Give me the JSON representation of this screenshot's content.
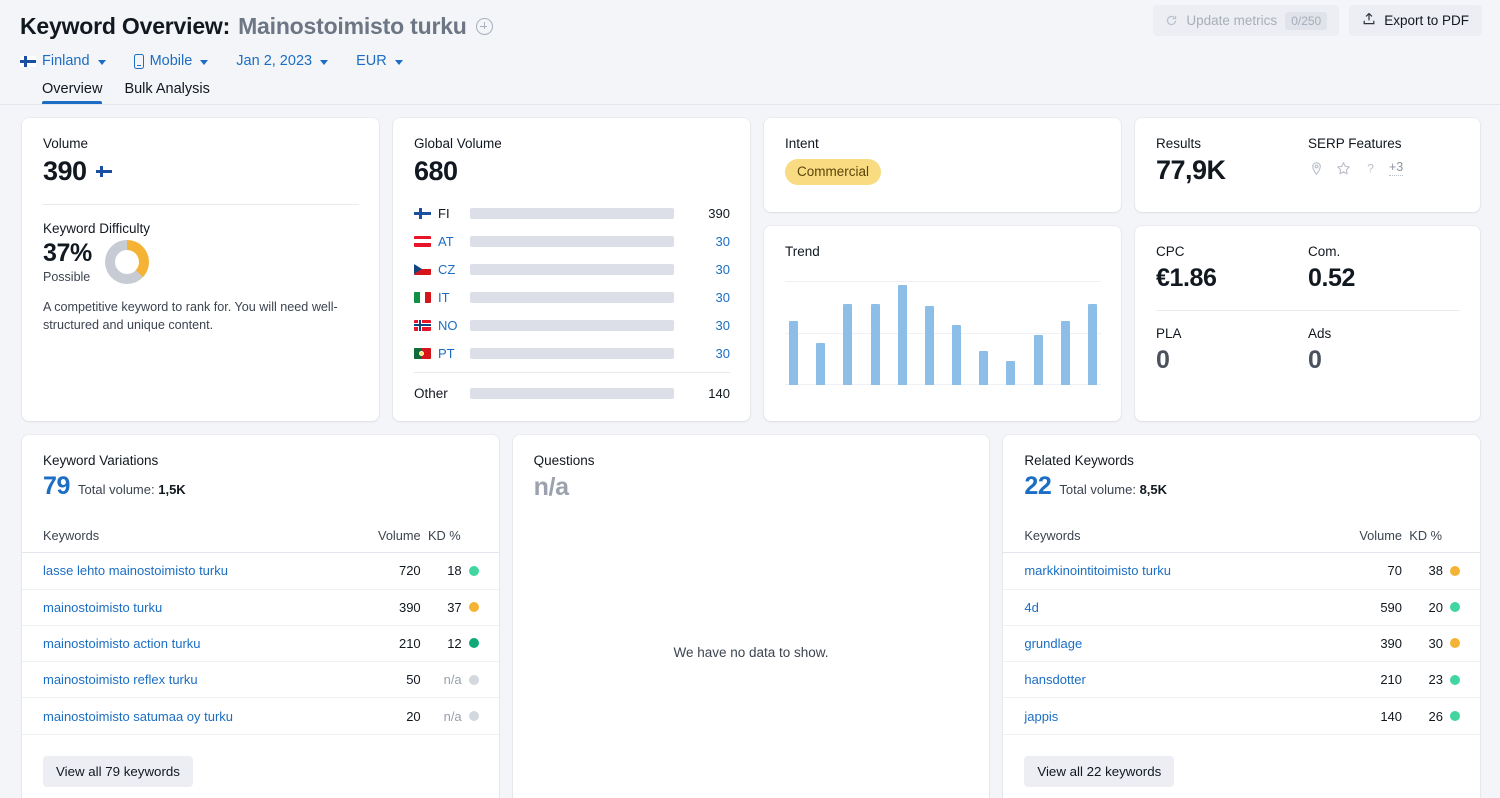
{
  "header": {
    "title_prefix": "Keyword Overview:",
    "keyword": "Mainostoimisto turku",
    "add_icon": "plus-circle-icon",
    "filters": [
      {
        "label": "Finland",
        "icon": "finland-flag-icon"
      },
      {
        "label": "Mobile",
        "icon": "mobile-device-icon"
      },
      {
        "label": "Jan 2, 2023",
        "icon": ""
      },
      {
        "label": "EUR",
        "icon": ""
      }
    ],
    "update_metrics_label": "Update metrics",
    "update_metrics_quota": "0/250",
    "export_label": "Export to PDF",
    "tabs": [
      {
        "label": "Overview",
        "active": true
      },
      {
        "label": "Bulk Analysis",
        "active": false
      }
    ]
  },
  "volume_card": {
    "label": "Volume",
    "value": "390",
    "flag_icon": "finland-flag-icon",
    "kd_label": "Keyword Difficulty",
    "kd_value": "37%",
    "kd_percent": 37,
    "kd_status": "Possible",
    "kd_color": "#f5b335",
    "kd_track_color": "#c6cbd4",
    "kd_description": "A competitive keyword to rank for. You will need well-structured and unique content."
  },
  "global_volume_card": {
    "label": "Global Volume",
    "value": "680",
    "rows": [
      {
        "code": "FI",
        "flag": "finland-flag-icon",
        "value": "390",
        "pct": 100,
        "color": "#1b6ec3",
        "primary": true
      },
      {
        "code": "AT",
        "flag": "austria-flag-icon",
        "value": "30",
        "pct": 7.7,
        "color": "#2f9ee8",
        "primary": false
      },
      {
        "code": "CZ",
        "flag": "czechia-flag-icon",
        "value": "30",
        "pct": 7.7,
        "color": "#2f9ee8",
        "primary": false
      },
      {
        "code": "IT",
        "flag": "italy-flag-icon",
        "value": "30",
        "pct": 7.7,
        "color": "#2f9ee8",
        "primary": false
      },
      {
        "code": "NO",
        "flag": "norway-flag-icon",
        "value": "30",
        "pct": 7.7,
        "color": "#2f9ee8",
        "primary": false
      },
      {
        "code": "PT",
        "flag": "portugal-flag-icon",
        "value": "30",
        "pct": 7.7,
        "color": "#2f9ee8",
        "primary": false
      }
    ],
    "other_label": "Other",
    "other_value": "140",
    "other_pct": 24,
    "other_color": "#2fb0f0"
  },
  "intent_card": {
    "label": "Intent",
    "value": "Commercial",
    "pill_bg": "#f9dc82",
    "pill_text_color": "#5a4409"
  },
  "trend_card": {
    "label": "Trend"
  },
  "results_card": {
    "results_label": "Results",
    "results_value": "77,9K",
    "serp_label": "SERP Features",
    "serp_icons": [
      "local-pack-pin-icon",
      "reviews-star-icon",
      "faq-question-icon"
    ],
    "serp_more": "+3"
  },
  "cpc_card": {
    "cpc_label": "CPC",
    "cpc_value": "€1.86",
    "com_label": "Com.",
    "com_value": "0.52",
    "pla_label": "PLA",
    "pla_value": "0",
    "ads_label": "Ads",
    "ads_value": "0"
  },
  "keyword_variations": {
    "title": "Keyword Variations",
    "count": "79",
    "total_volume_label": "Total volume:",
    "total_volume": "1,5K",
    "columns": {
      "keyword": "Keywords",
      "volume": "Volume",
      "kd": "KD %"
    },
    "rows": [
      {
        "keyword": "lasse lehto mainostoimisto turku",
        "volume": "720",
        "kd": "18",
        "kd_color": "#41d6a0"
      },
      {
        "keyword": "mainostoimisto turku",
        "volume": "390",
        "kd": "37",
        "kd_color": "#f5b335"
      },
      {
        "keyword": "mainostoimisto action turku",
        "volume": "210",
        "kd": "12",
        "kd_color": "#11a978"
      },
      {
        "keyword": "mainostoimisto reflex turku",
        "volume": "50",
        "kd": "n/a",
        "kd_color": "#d3d7de"
      },
      {
        "keyword": "mainostoimisto satumaa oy turku",
        "volume": "20",
        "kd": "n/a",
        "kd_color": "#d3d7de"
      }
    ],
    "view_all": "View all 79 keywords"
  },
  "questions": {
    "title": "Questions",
    "value": "n/a",
    "empty_message": "We have no data to show."
  },
  "related_keywords": {
    "title": "Related Keywords",
    "count": "22",
    "total_volume_label": "Total volume:",
    "total_volume": "8,5K",
    "columns": {
      "keyword": "Keywords",
      "volume": "Volume",
      "kd": "KD %"
    },
    "rows": [
      {
        "keyword": "markkinointitoimisto turku",
        "volume": "70",
        "kd": "38",
        "kd_color": "#f5b335"
      },
      {
        "keyword": "4d",
        "volume": "590",
        "kd": "20",
        "kd_color": "#41d6a0"
      },
      {
        "keyword": "grundlage",
        "volume": "390",
        "kd": "30",
        "kd_color": "#f5b335"
      },
      {
        "keyword": "hansdotter",
        "volume": "210",
        "kd": "23",
        "kd_color": "#41d6a0"
      },
      {
        "keyword": "jappis",
        "volume": "140",
        "kd": "26",
        "kd_color": "#41d6a0"
      }
    ],
    "view_all": "View all 22 keywords"
  },
  "chart_data": {
    "type": "bar",
    "title": "Trend",
    "categories": [
      "1",
      "2",
      "3",
      "4",
      "5",
      "6",
      "7",
      "8",
      "9",
      "10",
      "11",
      "12"
    ],
    "values": [
      62,
      40,
      78,
      78,
      96,
      76,
      58,
      33,
      23,
      48,
      62,
      78
    ],
    "xlabel": "",
    "ylabel": "",
    "ylim": [
      0,
      100
    ],
    "grid": true,
    "legend": "none",
    "bar_color": "#8cbee8"
  }
}
